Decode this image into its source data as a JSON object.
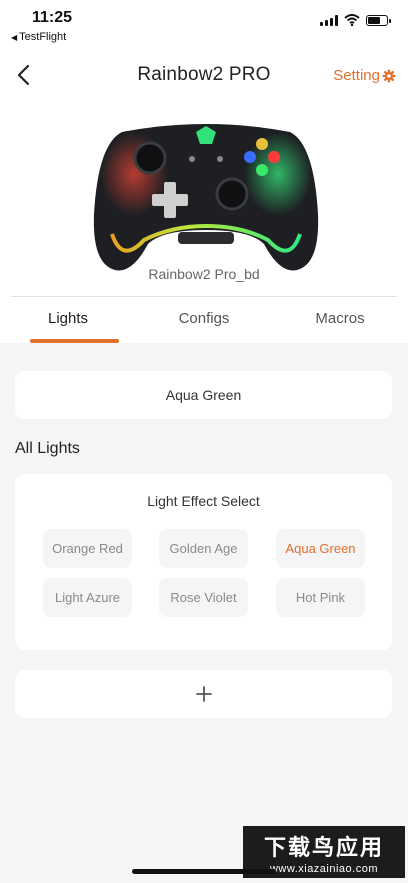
{
  "status_bar": {
    "time": "11:25",
    "back_app": "TestFlight",
    "icons": [
      "signal-icon",
      "wifi-icon",
      "battery-icon"
    ]
  },
  "header": {
    "title": "Rainbow2 PRO",
    "back_icon": "chevron-left-icon",
    "settings_label": "Setting",
    "settings_icon": "gear-icon"
  },
  "device": {
    "name": "Rainbow2 Pro_bd"
  },
  "tabs": [
    {
      "label": "Lights",
      "active": true
    },
    {
      "label": "Configs",
      "active": false
    },
    {
      "label": "Macros",
      "active": false
    }
  ],
  "current_light": "Aqua Green",
  "section_title": "All Lights",
  "effects": {
    "title": "Light Effect Select",
    "options": [
      {
        "label": "Orange Red",
        "active": false
      },
      {
        "label": "Golden Age",
        "active": false
      },
      {
        "label": "Aqua Green",
        "active": true
      },
      {
        "label": "Light Azure",
        "active": false
      },
      {
        "label": "Rose Violet",
        "active": false
      },
      {
        "label": "Hot Pink",
        "active": false
      }
    ]
  },
  "add_icon": "plus-icon",
  "watermark": {
    "line1": "下载鸟应用",
    "line2": "www.xiazainiao.com"
  },
  "colors": {
    "accent": "#e0702e",
    "background": "#f5f5f5",
    "card": "#ffffff"
  }
}
